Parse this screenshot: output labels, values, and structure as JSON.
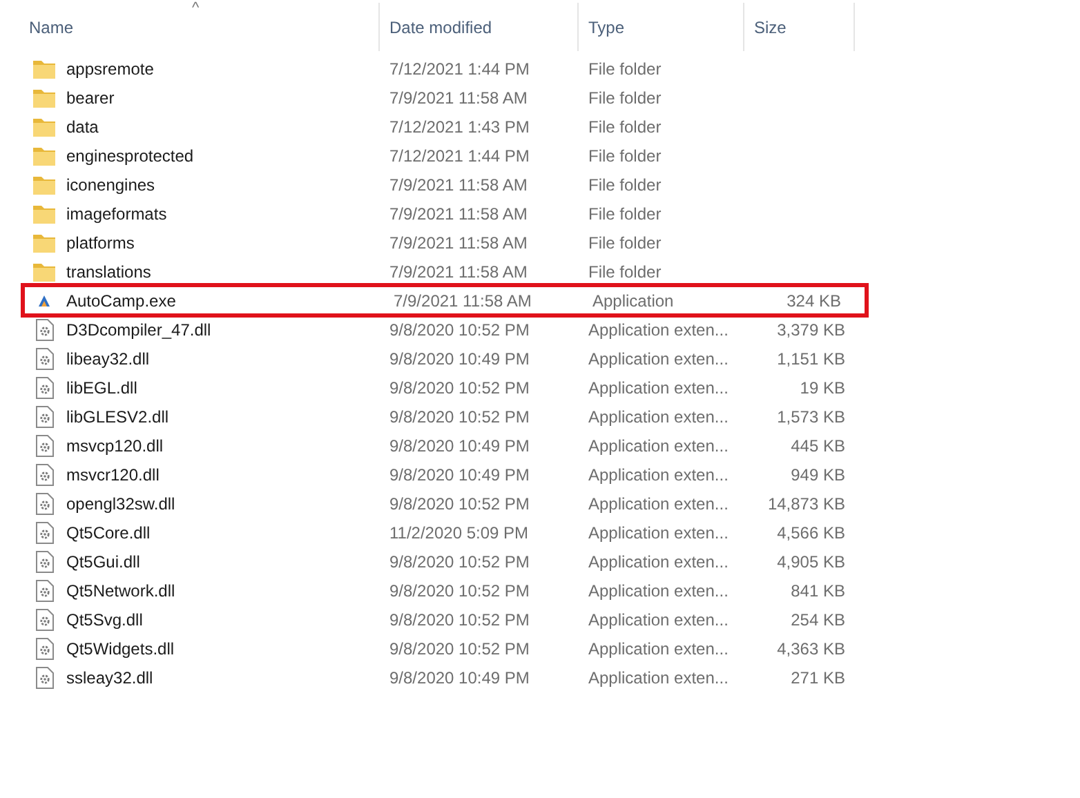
{
  "columns": [
    {
      "label": "Name",
      "sorted": true
    },
    {
      "label": "Date modified",
      "sorted": false
    },
    {
      "label": "Type",
      "sorted": false
    },
    {
      "label": "Size",
      "sorted": false
    }
  ],
  "sort_indicator": "^",
  "rows": [
    {
      "kind": "folder",
      "name": "appsremote",
      "date": "7/12/2021 1:44 PM",
      "type": "File folder",
      "highlighted": false
    },
    {
      "kind": "folder",
      "name": "bearer",
      "date": "7/9/2021 11:58 AM",
      "type": "File folder",
      "highlighted": false
    },
    {
      "kind": "folder",
      "name": "data",
      "date": "7/12/2021 1:43 PM",
      "type": "File folder",
      "highlighted": false
    },
    {
      "kind": "folder",
      "name": "enginesprotected",
      "date": "7/12/2021 1:44 PM",
      "type": "File folder",
      "highlighted": false
    },
    {
      "kind": "folder",
      "name": "iconengines",
      "date": "7/9/2021 11:58 AM",
      "type": "File folder",
      "highlighted": false
    },
    {
      "kind": "folder",
      "name": "imageformats",
      "date": "7/9/2021 11:58 AM",
      "type": "File folder",
      "highlighted": false
    },
    {
      "kind": "folder",
      "name": "platforms",
      "date": "7/9/2021 11:58 AM",
      "type": "File folder",
      "highlighted": false
    },
    {
      "kind": "folder",
      "name": "translations",
      "date": "7/9/2021 11:58 AM",
      "type": "File folder",
      "highlighted": false
    },
    {
      "kind": "exe",
      "name": "AutoCamp.exe",
      "date": "7/9/2021 11:58 AM",
      "type": "Application",
      "size": "324 KB",
      "highlighted": true
    },
    {
      "kind": "dll",
      "name": "D3Dcompiler_47.dll",
      "date": "9/8/2020 10:52 PM",
      "type": "Application exten...",
      "size": "3,379 KB",
      "highlighted": false
    },
    {
      "kind": "dll",
      "name": "libeay32.dll",
      "date": "9/8/2020 10:49 PM",
      "type": "Application exten...",
      "size": "1,151 KB",
      "highlighted": false
    },
    {
      "kind": "dll",
      "name": "libEGL.dll",
      "date": "9/8/2020 10:52 PM",
      "type": "Application exten...",
      "size": "19 KB",
      "highlighted": false
    },
    {
      "kind": "dll",
      "name": "libGLESV2.dll",
      "date": "9/8/2020 10:52 PM",
      "type": "Application exten...",
      "size": "1,573 KB",
      "highlighted": false
    },
    {
      "kind": "dll",
      "name": "msvcp120.dll",
      "date": "9/8/2020 10:49 PM",
      "type": "Application exten...",
      "size": "445 KB",
      "highlighted": false
    },
    {
      "kind": "dll",
      "name": "msvcr120.dll",
      "date": "9/8/2020 10:49 PM",
      "type": "Application exten...",
      "size": "949 KB",
      "highlighted": false
    },
    {
      "kind": "dll",
      "name": "opengl32sw.dll",
      "date": "9/8/2020 10:52 PM",
      "type": "Application exten...",
      "size": "14,873 KB",
      "highlighted": false
    },
    {
      "kind": "dll",
      "name": "Qt5Core.dll",
      "date": "11/2/2020 5:09 PM",
      "type": "Application exten...",
      "size": "4,566 KB",
      "highlighted": false
    },
    {
      "kind": "dll",
      "name": "Qt5Gui.dll",
      "date": "9/8/2020 10:52 PM",
      "type": "Application exten...",
      "size": "4,905 KB",
      "highlighted": false
    },
    {
      "kind": "dll",
      "name": "Qt5Network.dll",
      "date": "9/8/2020 10:52 PM",
      "type": "Application exten...",
      "size": "841 KB",
      "highlighted": false
    },
    {
      "kind": "dll",
      "name": "Qt5Svg.dll",
      "date": "9/8/2020 10:52 PM",
      "type": "Application exten...",
      "size": "254 KB",
      "highlighted": false
    },
    {
      "kind": "dll",
      "name": "Qt5Widgets.dll",
      "date": "9/8/2020 10:52 PM",
      "type": "Application exten...",
      "size": "4,363 KB",
      "highlighted": false
    },
    {
      "kind": "dll",
      "name": "ssleay32.dll",
      "date": "9/8/2020 10:49 PM",
      "type": "Application exten...",
      "size": "271 KB",
      "highlighted": false
    }
  ]
}
